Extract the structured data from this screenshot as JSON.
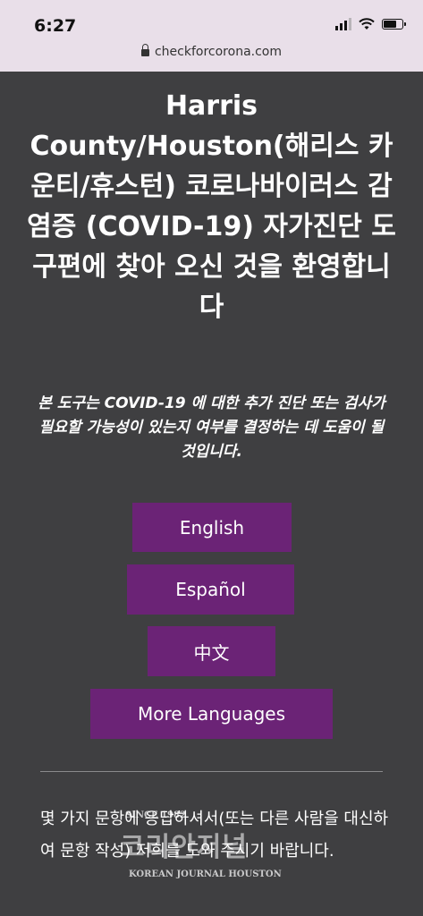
{
  "status_bar": {
    "time": "6:27"
  },
  "browser": {
    "url": "checkforcorona.com"
  },
  "page": {
    "title": "Harris County/Houston(해리스 카운티/휴스턴) 코로나바이러스 감염증 (COVID-19) 자가진단 도구편에 찾아 오신 것을 환영합니다",
    "subtitle": "본 도구는 COVID-19 에 대한 추가 진단 또는 검사가 필요할 가능성이 있는지 여부를 결정하는 데 도움이 될 것입니다.",
    "languages": [
      "English",
      "Español",
      "中文",
      "More Languages"
    ],
    "body_text": "몇 가지 문항에 응답하셔서(또는 다른 사람을 대신하여 문항 작성) 저희를 도와 주시기 바랍니다."
  },
  "watermark": {
    "since": "SINCE 1982",
    "name": "코리안저널",
    "sub": "KOREAN JOURNAL HOUSTON"
  },
  "colors": {
    "background": "#3f3f41",
    "button": "#6b2376",
    "topbar": "#e9dfe9"
  }
}
